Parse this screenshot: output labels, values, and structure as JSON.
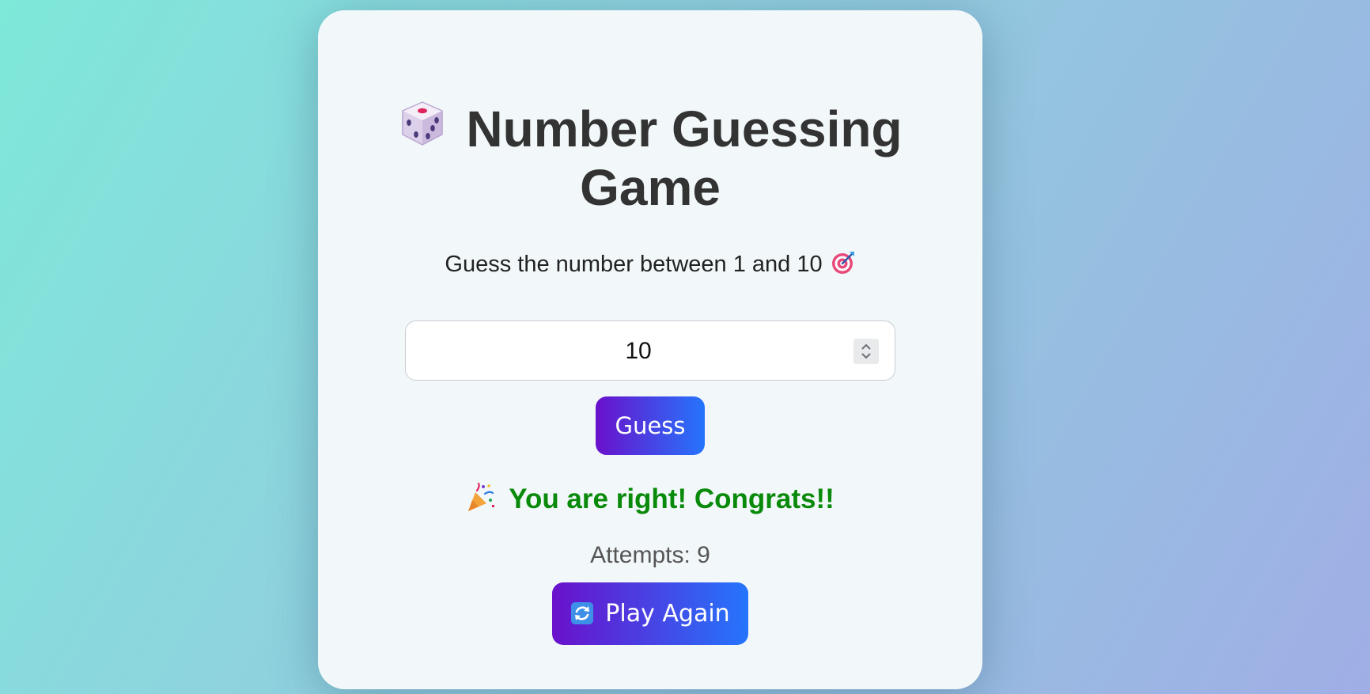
{
  "header": {
    "title_line1": "Number Guessing",
    "title_line2": "Game",
    "title_icon": "dice-icon"
  },
  "subtitle": {
    "text": "Guess the number between 1 and 10",
    "icon": "target-icon"
  },
  "guess_input": {
    "value": "10"
  },
  "guess_button": {
    "label": "Guess"
  },
  "result": {
    "message": "You are right! Congrats!!",
    "icon": "party-popper-icon",
    "color": "#0a8a0a"
  },
  "attempts": {
    "text": "Attempts: 9"
  },
  "play_again_button": {
    "label": "Play Again",
    "icon": "refresh-icon"
  },
  "theme": {
    "button_gradient_start": "#6a11cb",
    "button_gradient_end": "#2575fc",
    "title_color": "#333333",
    "card_background": "#f2f8fa"
  }
}
